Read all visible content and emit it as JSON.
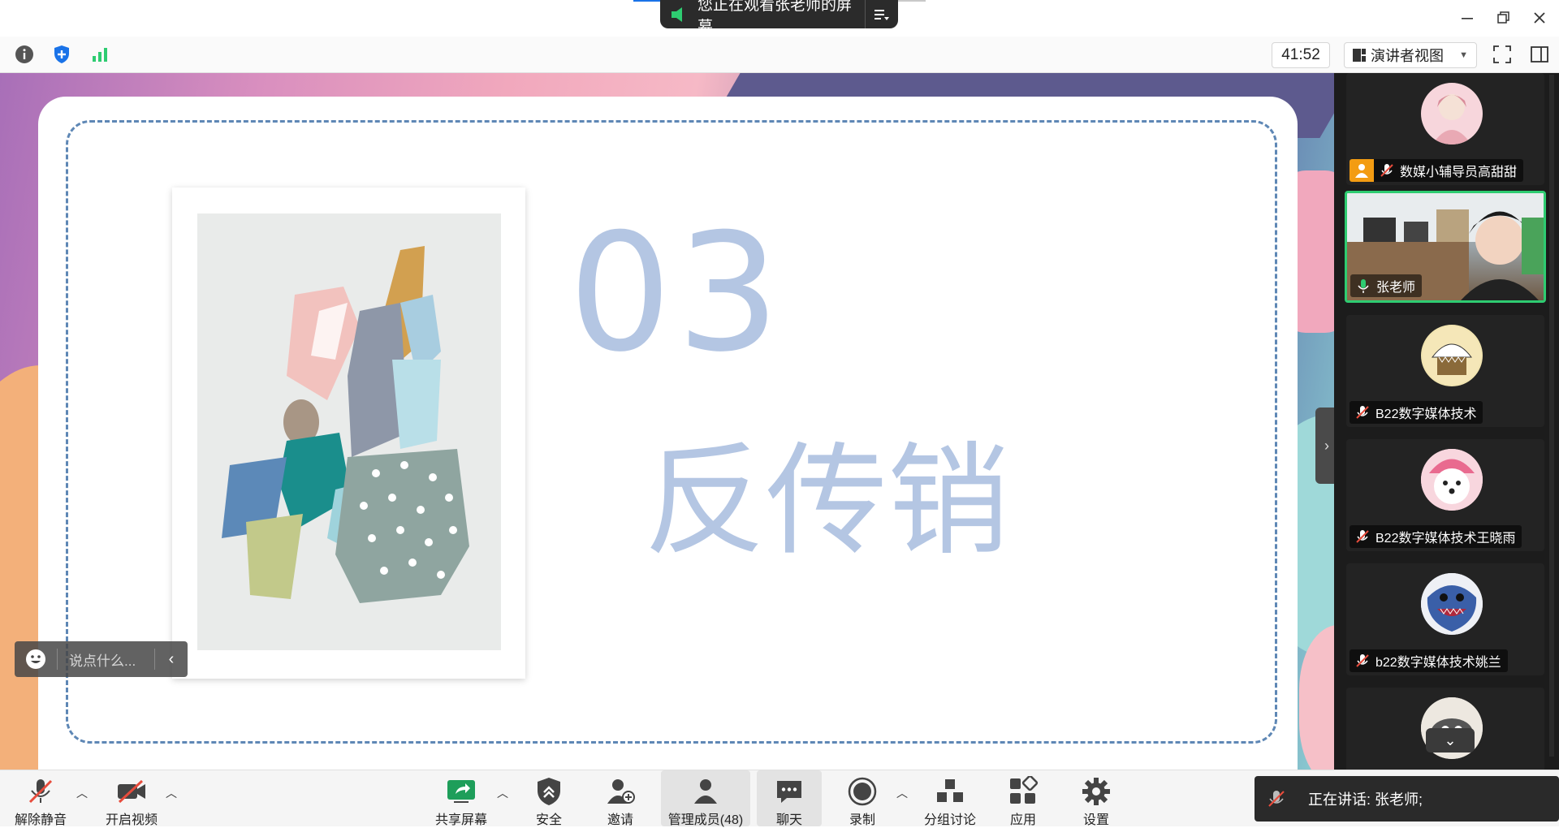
{
  "titlebar": {
    "share_notice": "您正在观看张老师的屏幕"
  },
  "toolbar": {
    "timer": "41:52",
    "view_mode": "演讲者视图"
  },
  "slide": {
    "number": "03",
    "heading": "反传销"
  },
  "chat_input": {
    "placeholder": "说点什么..."
  },
  "participants": [
    {
      "name": "数媒小辅导员高甜甜",
      "muted": true,
      "role": "host"
    },
    {
      "name": "张老师",
      "muted": false,
      "active_speaker": true,
      "video": true
    },
    {
      "name": "B22数字媒体技术",
      "muted": true
    },
    {
      "name": "B22数字媒体技术王晓雨",
      "muted": true
    },
    {
      "name": "b22数字媒体技术姚兰",
      "muted": true
    },
    {
      "name": "",
      "muted": true
    }
  ],
  "bottom_bar": {
    "unmute": "解除静音",
    "start_video": "开启视频",
    "share_screen": "共享屏幕",
    "security": "安全",
    "invite": "邀请",
    "manage_members": "管理成员(48)",
    "chat": "聊天",
    "record": "录制",
    "breakout": "分组讨论",
    "apps": "应用",
    "settings": "设置",
    "speaking_now": "正在讲话: 张老师;"
  },
  "colors": {
    "slide_accent": "#b4c6e3",
    "dash_border": "#5e87b5",
    "active_speaker_border": "#2ecc71",
    "share_pill_bg": "#2b2b2b"
  }
}
